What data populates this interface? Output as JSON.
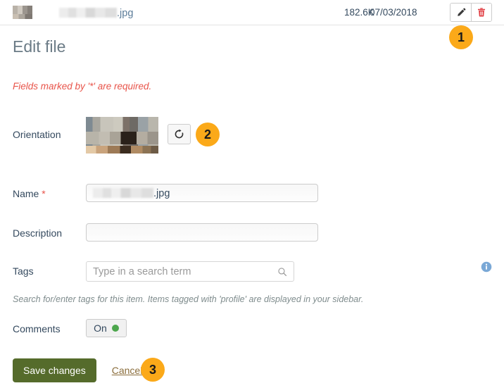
{
  "file_row": {
    "thumbnail_name": "file-thumbnail",
    "filename_redacted": true,
    "filename_extension": ".jpg",
    "size": "182.6K",
    "date": "07/03/2018",
    "edit_icon": "pencil-icon",
    "delete_icon": "trash-icon"
  },
  "page": {
    "title": "Edit file",
    "required_note": "Fields marked by '*' are required."
  },
  "form": {
    "orientation": {
      "label": "Orientation",
      "rotate_icon": "rotate-clockwise-icon"
    },
    "name": {
      "label": "Name",
      "required_marker": "*",
      "value_extension": ".jpg",
      "value_redacted": true
    },
    "description": {
      "label": "Description",
      "value": "",
      "placeholder": ""
    },
    "tags": {
      "label": "Tags",
      "value": "",
      "placeholder": "Type in a search term",
      "search_icon": "search-icon",
      "info_icon": "info-icon",
      "help_text": "Search for/enter tags for this item. Items tagged with 'profile' are displayed in your sidebar."
    },
    "comments": {
      "label": "Comments",
      "state_label": "On",
      "state_color": "#4ca64c"
    }
  },
  "footer": {
    "save_label": "Save changes",
    "cancel_label": "Cancel"
  },
  "callouts": [
    {
      "number": "1"
    },
    {
      "number": "2"
    },
    {
      "number": "3"
    }
  ],
  "colors": {
    "badge": "#fba919",
    "save_button": "#556b2b",
    "required_red": "#e8544a",
    "delete_red": "#e0393e",
    "link": "#8a6d3b",
    "toggle_on": "#4ca64c",
    "info_blue": "#7aa8d6"
  }
}
